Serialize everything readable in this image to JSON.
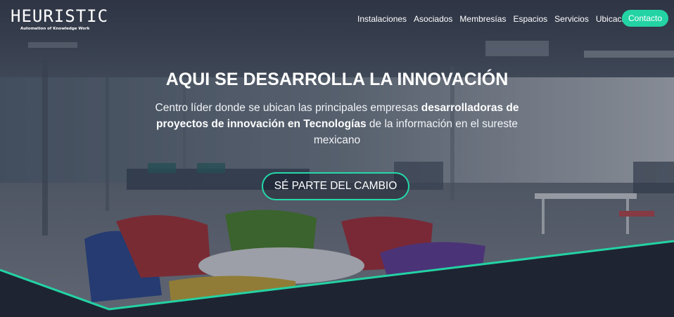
{
  "brand": {
    "name": "HEURISTIC",
    "tagline": "Automation of Knowledge Work"
  },
  "nav": {
    "items": [
      "Instalaciones",
      "Asociados",
      "Membresías",
      "Espacios",
      "Servicios",
      "Ubicación"
    ],
    "contact_label": "Contacto"
  },
  "hero": {
    "headline": "AQUI SE DESARROLLA LA INNOVACIÓN",
    "subtitle_part1": "Centro líder donde se ubican las principales empresas ",
    "subtitle_bold": "desarrolladoras de proyectos de innovación en Tecnologías",
    "subtitle_part2": " de la información en el sureste mexicano",
    "cta_label": "SÉ PARTE DEL CAMBIO"
  },
  "colors": {
    "accent": "#23d3a4",
    "footer_band": "#1f2433",
    "overlay": "#2a3147"
  }
}
